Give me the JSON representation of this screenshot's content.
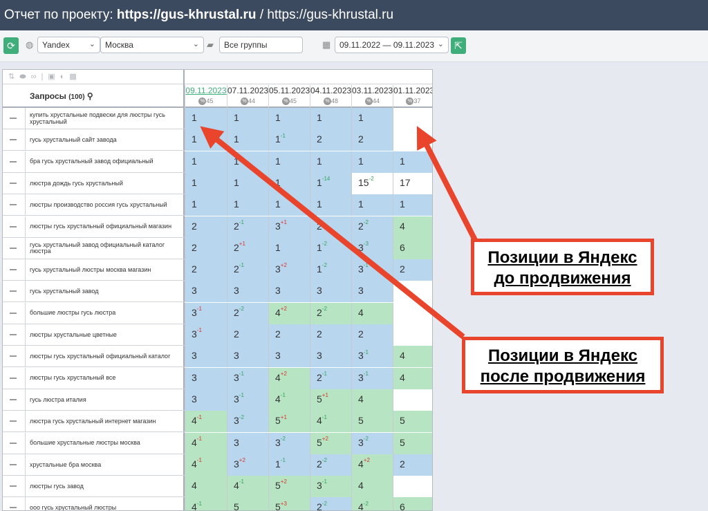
{
  "header": {
    "prefix": "Отчет по проекту: ",
    "project": "https://gus-khrustal.ru",
    "separator": " / ",
    "site": "https://gus-khrustal.ru"
  },
  "toolbar": {
    "engine": "Yandex",
    "region": "Москва",
    "groups": "Все группы",
    "period": "09.11.2022 — 09.11.2023"
  },
  "table": {
    "query_title": "Запросы",
    "query_count": "(100)",
    "columns": [
      {
        "date": "09.11.2023",
        "count": "45"
      },
      {
        "date": "07.11.2023",
        "count": "44"
      },
      {
        "date": "05.11.2023",
        "count": "45"
      },
      {
        "date": "04.11.2023",
        "count": "48"
      },
      {
        "date": "03.11.2023",
        "count": "44"
      },
      {
        "date": "01.11.2023",
        "count": "37"
      }
    ],
    "rows": [
      {
        "query": "купить хрустальные подвески для люстры гусь хрустальный",
        "cells": [
          [
            "1",
            "",
            "",
            "b"
          ],
          [
            "1",
            "",
            "",
            "b"
          ],
          [
            "1",
            "",
            "",
            "b"
          ],
          [
            "1",
            "",
            "",
            "b"
          ],
          [
            "1",
            "",
            "",
            "b"
          ],
          [
            "",
            "",
            "",
            "w"
          ]
        ]
      },
      {
        "query": "гусь хрустальный сайт завода",
        "cells": [
          [
            "1",
            "",
            "",
            "b"
          ],
          [
            "1",
            "",
            "",
            "b"
          ],
          [
            "1",
            "-1",
            "pos",
            "b"
          ],
          [
            "2",
            "",
            "",
            "b"
          ],
          [
            "2",
            "",
            "",
            "b"
          ],
          [
            "",
            "",
            "",
            "w"
          ]
        ]
      },
      {
        "query": "бра гусь хрустальный завод официальный",
        "cells": [
          [
            "1",
            "",
            "",
            "b"
          ],
          [
            "1",
            "",
            "",
            "b"
          ],
          [
            "1",
            "",
            "",
            "b"
          ],
          [
            "1",
            "",
            "",
            "b"
          ],
          [
            "1",
            "",
            "",
            "b"
          ],
          [
            "1",
            "",
            "",
            "b"
          ]
        ]
      },
      {
        "query": "люстра дождь гусь хрустальный",
        "cells": [
          [
            "1",
            "",
            "",
            "b"
          ],
          [
            "1",
            "",
            "",
            "b"
          ],
          [
            "1",
            "",
            "",
            "b"
          ],
          [
            "1",
            "-14",
            "pos",
            "b"
          ],
          [
            "15",
            "-2",
            "pos",
            "w"
          ],
          [
            "17",
            "",
            "",
            "w"
          ]
        ]
      },
      {
        "query": "люстры производство россия гусь хрустальный",
        "cells": [
          [
            "1",
            "",
            "",
            "b"
          ],
          [
            "1",
            "",
            "",
            "b"
          ],
          [
            "1",
            "",
            "",
            "b"
          ],
          [
            "1",
            "",
            "",
            "b"
          ],
          [
            "1",
            "",
            "",
            "b"
          ],
          [
            "1",
            "",
            "",
            "b"
          ]
        ]
      },
      {
        "query": "люстры гусь хрустальный официальный магазин",
        "cells": [
          [
            "2",
            "",
            "",
            "b"
          ],
          [
            "2",
            "-1",
            "pos",
            "b"
          ],
          [
            "3",
            "+1",
            "neg",
            "b"
          ],
          [
            "2",
            "",
            "",
            "b"
          ],
          [
            "2",
            "-2",
            "pos",
            "b"
          ],
          [
            "4",
            "",
            "",
            "g"
          ]
        ]
      },
      {
        "query": "гусь хрустальный завод официальный каталог люстра",
        "cells": [
          [
            "2",
            "",
            "",
            "b"
          ],
          [
            "2",
            "+1",
            "neg",
            "b"
          ],
          [
            "1",
            "",
            "",
            "b"
          ],
          [
            "1",
            "-2",
            "pos",
            "b"
          ],
          [
            "3",
            "-3",
            "pos",
            "b"
          ],
          [
            "6",
            "",
            "",
            "g"
          ]
        ]
      },
      {
        "query": "гусь хрустальный люстры москва магазин",
        "cells": [
          [
            "2",
            "",
            "",
            "b"
          ],
          [
            "2",
            "-1",
            "pos",
            "b"
          ],
          [
            "3",
            "+2",
            "neg",
            "b"
          ],
          [
            "1",
            "-2",
            "pos",
            "b"
          ],
          [
            "3",
            "-1",
            "pos",
            "b"
          ],
          [
            "2",
            "",
            "",
            "b"
          ]
        ]
      },
      {
        "query": "гусь хрустальный завод",
        "cells": [
          [
            "3",
            "",
            "",
            "b"
          ],
          [
            "3",
            "",
            "",
            "b"
          ],
          [
            "3",
            "",
            "",
            "b"
          ],
          [
            "3",
            "",
            "",
            "b"
          ],
          [
            "3",
            "",
            "",
            "b"
          ],
          [
            "",
            "",
            "",
            "w"
          ]
        ]
      },
      {
        "query": "большие люстры гусь люстра",
        "cells": [
          [
            "3",
            "-1",
            "neg",
            "b"
          ],
          [
            "2",
            "-2",
            "pos",
            "b"
          ],
          [
            "4",
            "+2",
            "neg",
            "g"
          ],
          [
            "2",
            "-2",
            "pos",
            "g"
          ],
          [
            "4",
            "",
            "",
            "g"
          ],
          [
            "",
            "",
            "",
            "w"
          ]
        ]
      },
      {
        "query": "люстры хрустальные цветные",
        "cells": [
          [
            "3",
            "-1",
            "neg",
            "b"
          ],
          [
            "2",
            "",
            "",
            "b"
          ],
          [
            "2",
            "",
            "",
            "b"
          ],
          [
            "2",
            "",
            "",
            "b"
          ],
          [
            "2",
            "",
            "",
            "b"
          ],
          [
            "",
            "",
            "",
            "w"
          ]
        ]
      },
      {
        "query": "люстры гусь хрустальный официальный каталог",
        "cells": [
          [
            "3",
            "",
            "",
            "b"
          ],
          [
            "3",
            "",
            "",
            "b"
          ],
          [
            "3",
            "",
            "",
            "b"
          ],
          [
            "3",
            "",
            "",
            "b"
          ],
          [
            "3",
            "-1",
            "pos",
            "b"
          ],
          [
            "4",
            "",
            "",
            "g"
          ]
        ]
      },
      {
        "query": "люстры гусь хрустальный все",
        "cells": [
          [
            "3",
            "",
            "",
            "b"
          ],
          [
            "3",
            "-1",
            "pos",
            "b"
          ],
          [
            "4",
            "+2",
            "neg",
            "g"
          ],
          [
            "2",
            "-1",
            "pos",
            "b"
          ],
          [
            "3",
            "-1",
            "pos",
            "b"
          ],
          [
            "4",
            "",
            "",
            "g"
          ]
        ]
      },
      {
        "query": "гусь люстра италия",
        "cells": [
          [
            "3",
            "",
            "",
            "b"
          ],
          [
            "3",
            "-1",
            "pos",
            "b"
          ],
          [
            "4",
            "-1",
            "pos",
            "g"
          ],
          [
            "5",
            "+1",
            "neg",
            "g"
          ],
          [
            "4",
            "",
            "",
            "g"
          ],
          [
            "",
            "",
            "",
            "w"
          ]
        ]
      },
      {
        "query": "люстра гусь хрустальный интернет магазин",
        "cells": [
          [
            "4",
            "-1",
            "neg",
            "g"
          ],
          [
            "3",
            "-2",
            "pos",
            "b"
          ],
          [
            "5",
            "+1",
            "neg",
            "g"
          ],
          [
            "4",
            "-1",
            "pos",
            "g"
          ],
          [
            "5",
            "",
            "",
            "g"
          ],
          [
            "5",
            "",
            "",
            "g"
          ]
        ]
      },
      {
        "query": "большие хрустальные люстры москва",
        "cells": [
          [
            "4",
            "-1",
            "neg",
            "g"
          ],
          [
            "3",
            "",
            "",
            "b"
          ],
          [
            "3",
            "-2",
            "pos",
            "b"
          ],
          [
            "5",
            "+2",
            "neg",
            "g"
          ],
          [
            "3",
            "-2",
            "pos",
            "b"
          ],
          [
            "5",
            "",
            "",
            "g"
          ]
        ]
      },
      {
        "query": "хрустальные бра москва",
        "cells": [
          [
            "4",
            "-1",
            "neg",
            "g"
          ],
          [
            "3",
            "+2",
            "neg",
            "b"
          ],
          [
            "1",
            "-1",
            "pos",
            "b"
          ],
          [
            "2",
            "-2",
            "pos",
            "b"
          ],
          [
            "4",
            "+2",
            "neg",
            "g"
          ],
          [
            "2",
            "",
            "",
            "b"
          ]
        ]
      },
      {
        "query": "люстры гусь завод",
        "cells": [
          [
            "4",
            "",
            "",
            "g"
          ],
          [
            "4",
            "-1",
            "pos",
            "g"
          ],
          [
            "5",
            "+2",
            "neg",
            "g"
          ],
          [
            "3",
            "-1",
            "pos",
            "g"
          ],
          [
            "4",
            "",
            "",
            "g"
          ],
          [
            "",
            "",
            "",
            "w"
          ]
        ]
      },
      {
        "query": "ооо гусь хрустальный люстры",
        "cells": [
          [
            "4",
            "-1",
            "pos",
            "g"
          ],
          [
            "5",
            "",
            "",
            "g"
          ],
          [
            "5",
            "+3",
            "neg",
            "g"
          ],
          [
            "2",
            "-2",
            "pos",
            "b"
          ],
          [
            "4",
            "-2",
            "pos",
            "g"
          ],
          [
            "6",
            "",
            "",
            "g"
          ]
        ]
      }
    ]
  },
  "callouts": {
    "before": {
      "line1": "Позиции в Яндекс",
      "line2": "до продвижения"
    },
    "after": {
      "line1": "Позиции в Яндекс",
      "line2": "после продвижения"
    }
  },
  "colors": {
    "arrow": "#e8452c",
    "header_bg": "#3b4a5f",
    "cell_blue": "#b9d6ef",
    "cell_green": "#b7e4c2",
    "accent": "#3fae7a"
  }
}
